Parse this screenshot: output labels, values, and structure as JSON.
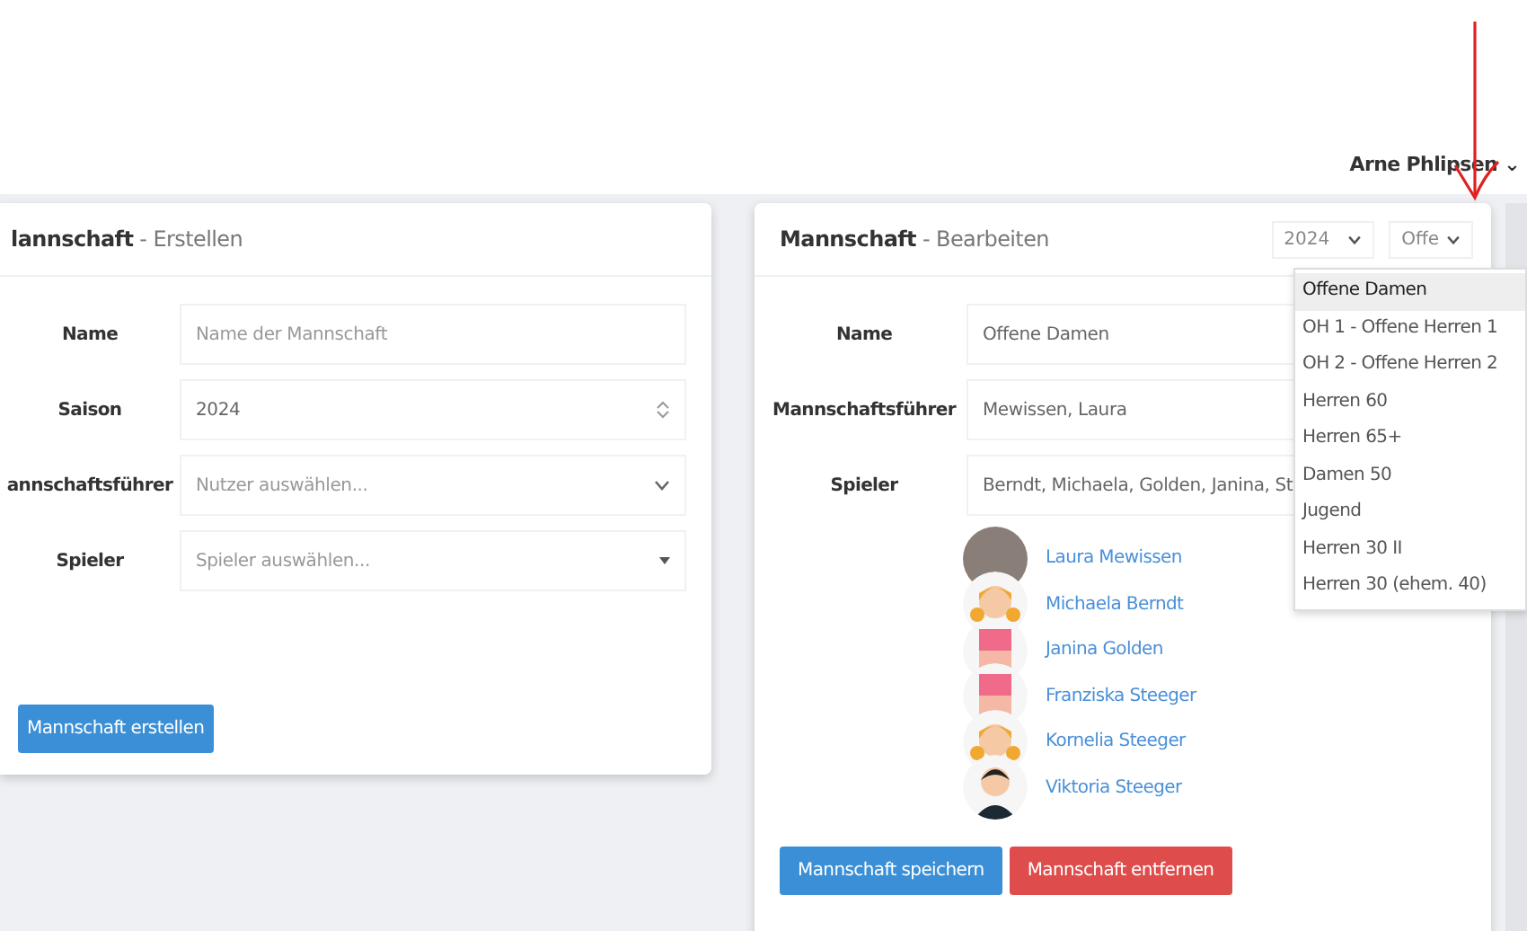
{
  "user_menu": {
    "name": "Arne Phlipsen",
    "caret": "⌄"
  },
  "create_card": {
    "title_bold": "lannschaft",
    "title_rest": "- Erstellen",
    "fields": [
      {
        "label": "Name",
        "kind": "text",
        "placeholder": "Name der Mannschaft"
      },
      {
        "label": "Saison",
        "kind": "number",
        "value": "2024"
      },
      {
        "label": "annschaftsführer",
        "kind": "select",
        "placeholder": "Nutzer auswählen..."
      },
      {
        "label": "Spieler",
        "kind": "multiselect",
        "placeholder": "Spieler auswählen..."
      }
    ],
    "button": "Mannschaft erstellen"
  },
  "edit_card": {
    "title_bold": "Mannschaft",
    "title_rest": "- Bearbeiten",
    "year_select": "2024",
    "team_select": "Offe",
    "fields": [
      {
        "label": "Name",
        "value": "Offene Damen"
      },
      {
        "label": "Mannschaftsführer",
        "value": "Mewissen, Laura"
      },
      {
        "label": "Spieler",
        "value": "Berndt, Michaela, Golden, Janina, St"
      }
    ],
    "players": [
      {
        "name": "Laura Mewissen",
        "kind": "photo"
      },
      {
        "name": "Michaela Berndt",
        "kind": "girl"
      },
      {
        "name": "Janina Golden",
        "kind": "shirt"
      },
      {
        "name": "Franziska Steeger",
        "kind": "shirt"
      },
      {
        "name": "Kornelia Steeger",
        "kind": "girl"
      },
      {
        "name": "Viktoria Steeger",
        "kind": "boy"
      }
    ],
    "save_button": "Mannschaft speichern",
    "delete_button": "Mannschaft entfernen"
  },
  "team_dropdown": [
    {
      "label": "Offene Damen",
      "selected": true
    },
    {
      "label": "OH 1 - Offene Herren 1",
      "selected": false
    },
    {
      "label": "OH 2 - Offene Herren 2",
      "selected": false
    },
    {
      "label": "Herren 60",
      "selected": false
    },
    {
      "label": "Herren 65+",
      "selected": false
    },
    {
      "label": "Damen 50",
      "selected": false
    },
    {
      "label": "Jugend",
      "selected": false
    },
    {
      "label": "Herren 30 II",
      "selected": false
    },
    {
      "label": "Herren 30 (ehem. 40)",
      "selected": false
    }
  ]
}
